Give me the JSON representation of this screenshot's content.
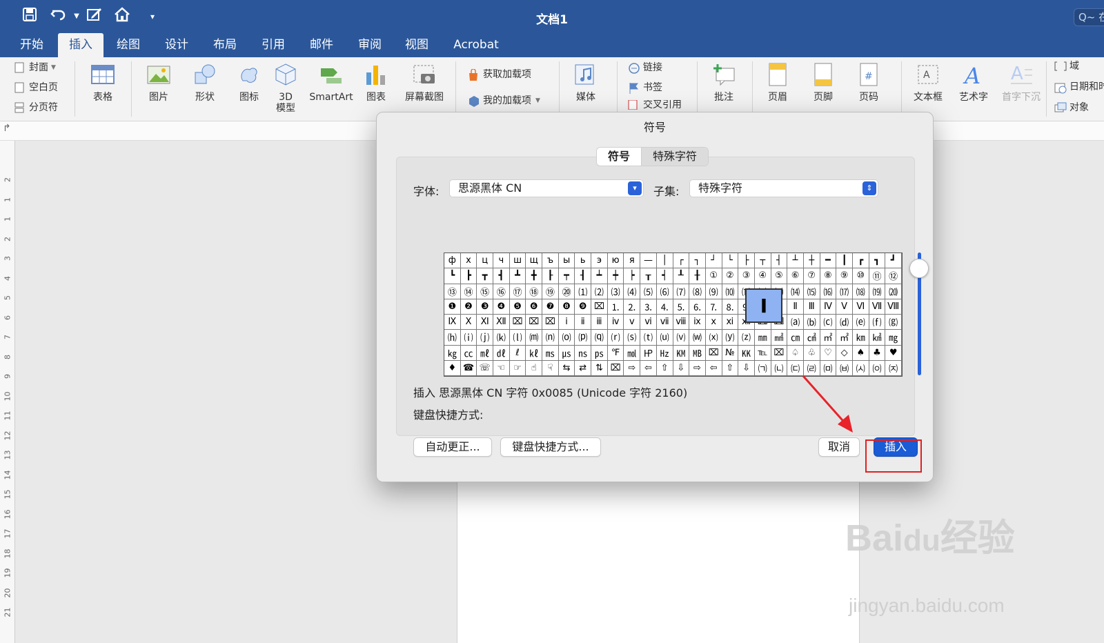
{
  "window": {
    "title": "文档1",
    "search_placeholder": "Q~ 在"
  },
  "quick_access": {
    "save_icon": "save-icon",
    "undo_icon": "undo-icon",
    "edit_icon": "edit-icon",
    "home_icon": "home-icon",
    "more_icon": "customize-icon"
  },
  "tabs": [
    {
      "label": "开始"
    },
    {
      "label": "插入"
    },
    {
      "label": "绘图"
    },
    {
      "label": "设计"
    },
    {
      "label": "布局"
    },
    {
      "label": "引用"
    },
    {
      "label": "邮件"
    },
    {
      "label": "审阅"
    },
    {
      "label": "视图"
    },
    {
      "label": "Acrobat"
    }
  ],
  "active_tab": "插入",
  "ribbon": {
    "pages": {
      "cover": "封面",
      "blank": "空白页",
      "break": "分页符"
    },
    "table": "表格",
    "picture": "图片",
    "shape": "形状",
    "icon": "图标",
    "model3d": "3D\n模型",
    "smartart": "SmartArt",
    "chart": "图表",
    "screenshot": "屏幕截图",
    "get_addins": "获取加载项",
    "my_addins": "我的加载项",
    "media": "媒体",
    "link": "链接",
    "bookmark": "书签",
    "crossref": "交叉引用",
    "comment": "批注",
    "header": "页眉",
    "footer": "页脚",
    "pagenum": "页码",
    "textbox": "文本框",
    "wordart": "艺术字",
    "dropcap": "首字下沉",
    "field": "域",
    "datetime": "日期和时",
    "object": "对象"
  },
  "ruler_numbers": [
    "2",
    "1",
    "1",
    "2",
    "3",
    "4",
    "5",
    "6",
    "7",
    "8",
    "9",
    "10",
    "11",
    "12",
    "13",
    "14",
    "15",
    "16",
    "17",
    "18",
    "19",
    "20",
    "21"
  ],
  "dialog": {
    "title": "符号",
    "tabs": [
      "符号",
      "特殊字符"
    ],
    "font_label": "字体:",
    "font_value": "思源黑体 CN",
    "subset_label": "子集:",
    "subset_value": "特殊字符",
    "grid_rows": [
      [
        "ф",
        "х",
        "ц",
        "ч",
        "ш",
        "щ",
        "ъ",
        "ы",
        "ь",
        "э",
        "ю",
        "я",
        "—",
        "│",
        "┌",
        "┐",
        "┘",
        "└",
        "├",
        "┬",
        "┤",
        "┴",
        "┼",
        "━",
        "┃",
        "┏",
        "┓",
        "┛"
      ],
      [
        "┗",
        "┣",
        "┳",
        "┫",
        "┻",
        "╋",
        "┠",
        "┯",
        "┨",
        "┷",
        "┿",
        "┝",
        "┰",
        "┥",
        "┸",
        "╂",
        "①",
        "②",
        "③",
        "④",
        "⑤",
        "⑥",
        "⑦",
        "⑧",
        "⑨",
        "⑩",
        "⑪",
        "⑫"
      ],
      [
        "⑬",
        "⑭",
        "⑮",
        "⑯",
        "⑰",
        "⑱",
        "⑲",
        "⑳",
        "⑴",
        "⑵",
        "⑶",
        "⑷",
        "⑸",
        "⑹",
        "⑺",
        "⑻",
        "⑼",
        "⑽",
        "⑾",
        "⑿",
        "⒀",
        "⒁",
        "⒂",
        "⒃",
        "⒄",
        "⒅",
        "⒆",
        "⒇"
      ],
      [
        "❶",
        "❷",
        "❸",
        "❹",
        "❺",
        "❻",
        "❼",
        "❽",
        "❾",
        "⌧",
        "⒈",
        "⒉",
        "⒊",
        "⒋",
        "⒌",
        "⒍",
        "⒎",
        "⒏",
        "⒐",
        "⒑",
        "Ⅰ",
        "Ⅱ",
        "Ⅲ",
        "Ⅳ",
        "Ⅴ",
        "Ⅵ",
        "Ⅶ",
        "Ⅷ"
      ],
      [
        "Ⅸ",
        "Ⅹ",
        "Ⅺ",
        "Ⅻ",
        "⌧",
        "⌧",
        "⌧",
        "ⅰ",
        "ⅱ",
        "ⅲ",
        "ⅳ",
        "ⅴ",
        "ⅵ",
        "ⅶ",
        "ⅷ",
        "ⅸ",
        "ⅹ",
        "ⅺ",
        "ⅻ",
        "⌧",
        "⌧",
        "⒜",
        "⒝",
        "⒞",
        "⒟",
        "⒠",
        "⒡",
        "⒢"
      ],
      [
        "⒣",
        "⒤",
        "⒥",
        "⒦",
        "⒧",
        "⒨",
        "⒩",
        "⒪",
        "⒫",
        "⒬",
        "⒭",
        "⒮",
        "⒯",
        "⒰",
        "⒱",
        "⒲",
        "⒳",
        "⒴",
        "⒵",
        "㎜",
        "㎟",
        "㎝",
        "㎠",
        "㎡",
        "㎡",
        "㎞",
        "㎢",
        "㎎"
      ],
      [
        "㎏",
        "㏄",
        "㎖",
        "㎗",
        "ℓ",
        "㎘",
        "㎳",
        "㎲",
        "㎱",
        "㎰",
        "℉",
        "㏖",
        "㏋",
        "㎐",
        "㏎",
        "㎆",
        "⌧",
        "№",
        "㏍",
        "℡",
        "⌧",
        "♤",
        "♧",
        "♡",
        "◇",
        "♠",
        "♣",
        "♥"
      ],
      [
        "♦",
        "☎",
        "☏",
        "☜",
        "☞",
        "☝",
        "☟",
        "⇆",
        "⇄",
        "⇅",
        "⌧",
        "⇨",
        "⇦",
        "⇧",
        "⇩",
        "⇨",
        "⇦",
        "⇧",
        "⇩",
        "㈀",
        "㈁",
        "㈂",
        "㈃",
        "㈄",
        "㈅",
        "㈆",
        "㈇",
        "㈈"
      ]
    ],
    "magnified_char": "Ⅰ",
    "info_text": "插入 思源黑体 CN 字符 0x0085 (Unicode 字符 2160)",
    "shortcut_label": "键盘快捷方式:",
    "autocorrect_button": "自动更正...",
    "shortcut_button": "键盘快捷方式...",
    "cancel_button": "取消",
    "insert_button": "插入"
  },
  "watermark": {
    "brand": "Baidu经验",
    "url": "jingyan.baidu.com"
  },
  "colors": {
    "ribbon_blue": "#2b579a",
    "primary_button": "#1a5bd6",
    "highlight_red": "#e02020",
    "arrow_red": "#e8232a"
  }
}
